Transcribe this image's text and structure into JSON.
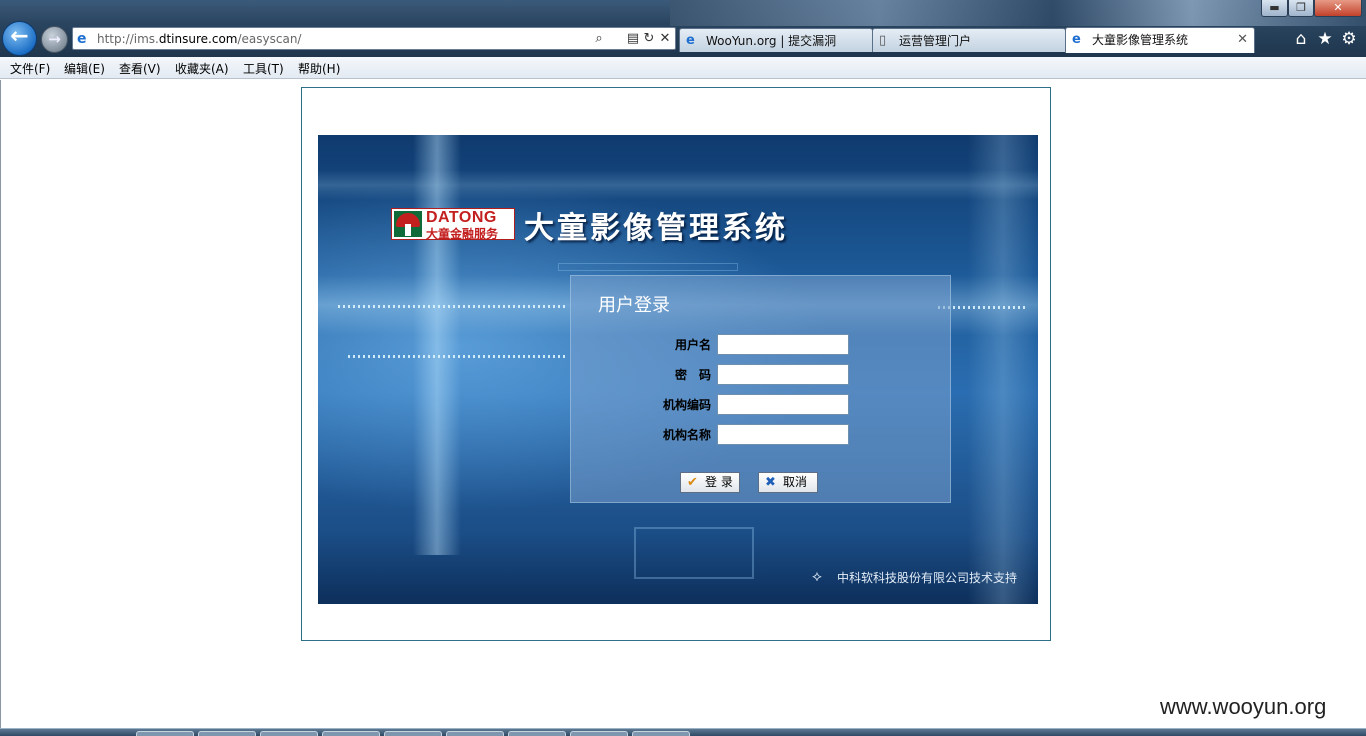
{
  "browser": {
    "window_controls": {
      "minimize": "▬",
      "maximize": "❐",
      "close": "✕"
    },
    "nav": {
      "back_icon": "arrow-left-icon",
      "forward_icon": "arrow-right-icon"
    },
    "address": {
      "url_prefix": "http://ims.",
      "url_domain": "dtinsure.com",
      "url_path": "/easyscan/"
    },
    "tabs": [
      {
        "label": "WooYun.org | 提交漏洞",
        "icon": "ie-icon"
      },
      {
        "label": "运营管理门户",
        "icon": "page-icon"
      },
      {
        "label": "大童影像管理系统",
        "icon": "ie-icon",
        "active": true
      }
    ],
    "toolbar_icons": [
      "home-icon",
      "favorites-star-icon",
      "tools-gear-icon"
    ]
  },
  "menubar": {
    "items": [
      "文件(F)",
      "编辑(E)",
      "查看(V)",
      "收藏夹(A)",
      "工具(T)",
      "帮助(H)"
    ]
  },
  "page": {
    "logo": {
      "en": "DATONG",
      "cn": "大童金融服务"
    },
    "system_title": "大童影像管理系统",
    "login": {
      "title": "用户登录",
      "fields": [
        {
          "label": "用户名",
          "value": ""
        },
        {
          "label": "密　码",
          "value": ""
        },
        {
          "label": "机构编码",
          "value": ""
        },
        {
          "label": "机构名称",
          "value": ""
        }
      ],
      "login_button": "登 录",
      "cancel_button": "取消"
    },
    "support_text": "中科软科技股份有限公司技术支持"
  },
  "watermark": "www.wooyun.org",
  "colors": {
    "banner_dark": "#0f3a6e",
    "banner_mid": "#2a6db0",
    "logo_red": "#c31f1f",
    "logo_green": "#0f6a3a",
    "frame_border": "#2b6f88"
  }
}
